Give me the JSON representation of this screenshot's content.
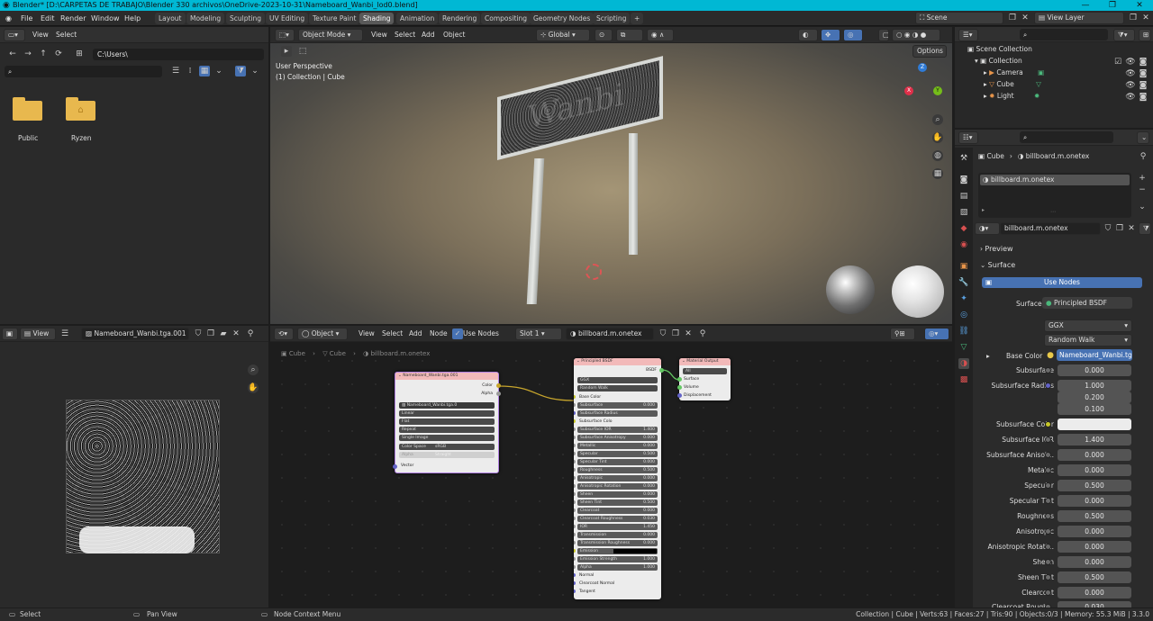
{
  "window": {
    "title": "Blender* [D:\\CARPETAS DE TRABAJO\\Blender 330 archivos\\OneDrive-2023-10-31\\Nameboard_Wanbi_lod0.blend]",
    "controls": [
      "—",
      "❐",
      "✕"
    ]
  },
  "menus": [
    "File",
    "Edit",
    "Render",
    "Window",
    "Help"
  ],
  "workspaces": [
    "Layout",
    "Modeling",
    "Sculpting",
    "UV Editing",
    "Texture Paint",
    "Shading",
    "Animation",
    "Rendering",
    "Compositing",
    "Geometry Nodes",
    "Scripting"
  ],
  "active_workspace": "Shading",
  "scene": {
    "name": "Scene",
    "view_layer": "View Layer"
  },
  "file_browser": {
    "menu": [
      "View",
      "Select"
    ],
    "path": "C:\\Users\\",
    "items": [
      {
        "label": "Public"
      },
      {
        "label": "Ryzen"
      }
    ]
  },
  "viewport": {
    "mode": "Object Mode",
    "menu": [
      "View",
      "Select",
      "Add",
      "Object"
    ],
    "orientation": "Global",
    "options": "Options",
    "info_line1": "User Perspective",
    "info_line2": "(1) Collection | Cube",
    "sign_text": "Wanbi",
    "gizmo": {
      "x": "X",
      "y": "Y",
      "z": "Z"
    }
  },
  "image_editor": {
    "view": "View",
    "image_name": "Nameboard_Wanbi.tga.001"
  },
  "node_editor": {
    "type": "Object",
    "menu": [
      "View",
      "Select",
      "Add",
      "Node"
    ],
    "use_nodes": "Use Nodes",
    "slot": "Slot 1",
    "material": "billboard.m.onetex",
    "breadcrumb": [
      "Cube",
      "Cube",
      "billboard.m.onetex"
    ],
    "image_node": {
      "title": "Nameboard_Wanbi.tga.001",
      "outputs": [
        "Color",
        "Alpha"
      ],
      "image": "Nameboard_Wanbi.tga.0",
      "fields": [
        "Linear",
        "Flat",
        "Repeat",
        "Single Image"
      ],
      "color_space_label": "Color Space",
      "color_space": "sRGB",
      "alpha_label": "Alpha",
      "alpha_value": "Straight",
      "vector": "Vector"
    },
    "bsdf_node": {
      "title": "Principled BSDF",
      "output": "BSDF",
      "distribution": "GGX",
      "subsurface_method": "Random Walk",
      "rows": [
        {
          "label": "Base Color",
          "value": ""
        },
        {
          "label": "Subsurface",
          "value": "0.000"
        },
        {
          "label": "Subsurface Radius",
          "value": ""
        },
        {
          "label": "Subsurface Colo",
          "value": ""
        },
        {
          "label": "Subsurface IOR",
          "value": "1.400"
        },
        {
          "label": "Subsurface Anisotropy",
          "value": "0.000"
        },
        {
          "label": "Metallic",
          "value": "0.000"
        },
        {
          "label": "Specular",
          "value": "0.500"
        },
        {
          "label": "Specular Tint",
          "value": "0.000"
        },
        {
          "label": "Roughness",
          "value": "0.500"
        },
        {
          "label": "Anisotropic",
          "value": "0.000"
        },
        {
          "label": "Anisotropic Rotation",
          "value": "0.000"
        },
        {
          "label": "Sheen",
          "value": "0.000"
        },
        {
          "label": "Sheen Tint",
          "value": "0.500"
        },
        {
          "label": "Clearcoat",
          "value": "0.000"
        },
        {
          "label": "Clearcoat Roughness",
          "value": "0.030"
        },
        {
          "label": "IOR",
          "value": "1.450"
        },
        {
          "label": "Transmission",
          "value": "0.000"
        },
        {
          "label": "Transmission Roughness",
          "value": "0.000"
        },
        {
          "label": "Emission",
          "value": ""
        },
        {
          "label": "Emission Strength",
          "value": "1.000"
        },
        {
          "label": "Alpha",
          "value": "1.000"
        },
        {
          "label": "Normal",
          "value": ""
        },
        {
          "label": "Clearcoat Normal",
          "value": ""
        },
        {
          "label": "Tangent",
          "value": ""
        }
      ]
    },
    "output_node": {
      "title": "Material Output",
      "target": "All",
      "inputs": [
        "Surface",
        "Volume",
        "Displacement"
      ]
    }
  },
  "outliner": {
    "items": [
      {
        "label": "Scene Collection"
      },
      {
        "label": "Collection"
      },
      {
        "label": "Camera"
      },
      {
        "label": "Cube"
      },
      {
        "label": "Light"
      }
    ]
  },
  "properties": {
    "breadcrumb_object": "Cube",
    "breadcrumb_material": "billboard.m.onetex",
    "slot_material": "billboard.m.onetex",
    "material_name": "billboard.m.onetex",
    "sections": [
      "Preview",
      "Surface"
    ],
    "use_nodes": "Use Nodes",
    "surface_label": "Surface",
    "surface_value": "Principled BSDF",
    "distribution": "GGX",
    "subsurface_method": "Random Walk",
    "base_color_label": "Base Color",
    "base_color_value": "Nameboard_Wanbi.tga...",
    "rows": [
      {
        "label": "Subsurface",
        "value": "0.000"
      },
      {
        "label": "Subsurface Radius",
        "value": "1.000"
      },
      {
        "label": "",
        "value": "0.200"
      },
      {
        "label": "",
        "value": "0.100"
      },
      {
        "label": "Subsurface Color",
        "value": ""
      },
      {
        "label": "Subsurface IOR",
        "value": "1.400"
      },
      {
        "label": "Subsurface Anisot...",
        "value": "0.000"
      },
      {
        "label": "Metallic",
        "value": "0.000"
      },
      {
        "label": "Specular",
        "value": "0.500"
      },
      {
        "label": "Specular Tint",
        "value": "0.000"
      },
      {
        "label": "Roughness",
        "value": "0.500"
      },
      {
        "label": "Anisotropic",
        "value": "0.000"
      },
      {
        "label": "Anisotropic Rotati...",
        "value": "0.000"
      },
      {
        "label": "Sheen",
        "value": "0.000"
      },
      {
        "label": "Sheen Tint",
        "value": "0.500"
      },
      {
        "label": "Clearcoat",
        "value": "0.000"
      },
      {
        "label": "Clearcoat Rough...",
        "value": "0.030"
      }
    ]
  },
  "statusbar": {
    "select": "Select",
    "pan": "Pan View",
    "context": "Node Context Menu",
    "info": "Collection | Cube | Verts:63 | Faces:27 | Tris:90 | Objects:0/3 | Memory: 55.3 MiB | 3.3.0"
  },
  "colors": {
    "accent": "#4772b3",
    "title_bar": "#00b8d4",
    "node_header_shader": "#f2b9b9"
  }
}
